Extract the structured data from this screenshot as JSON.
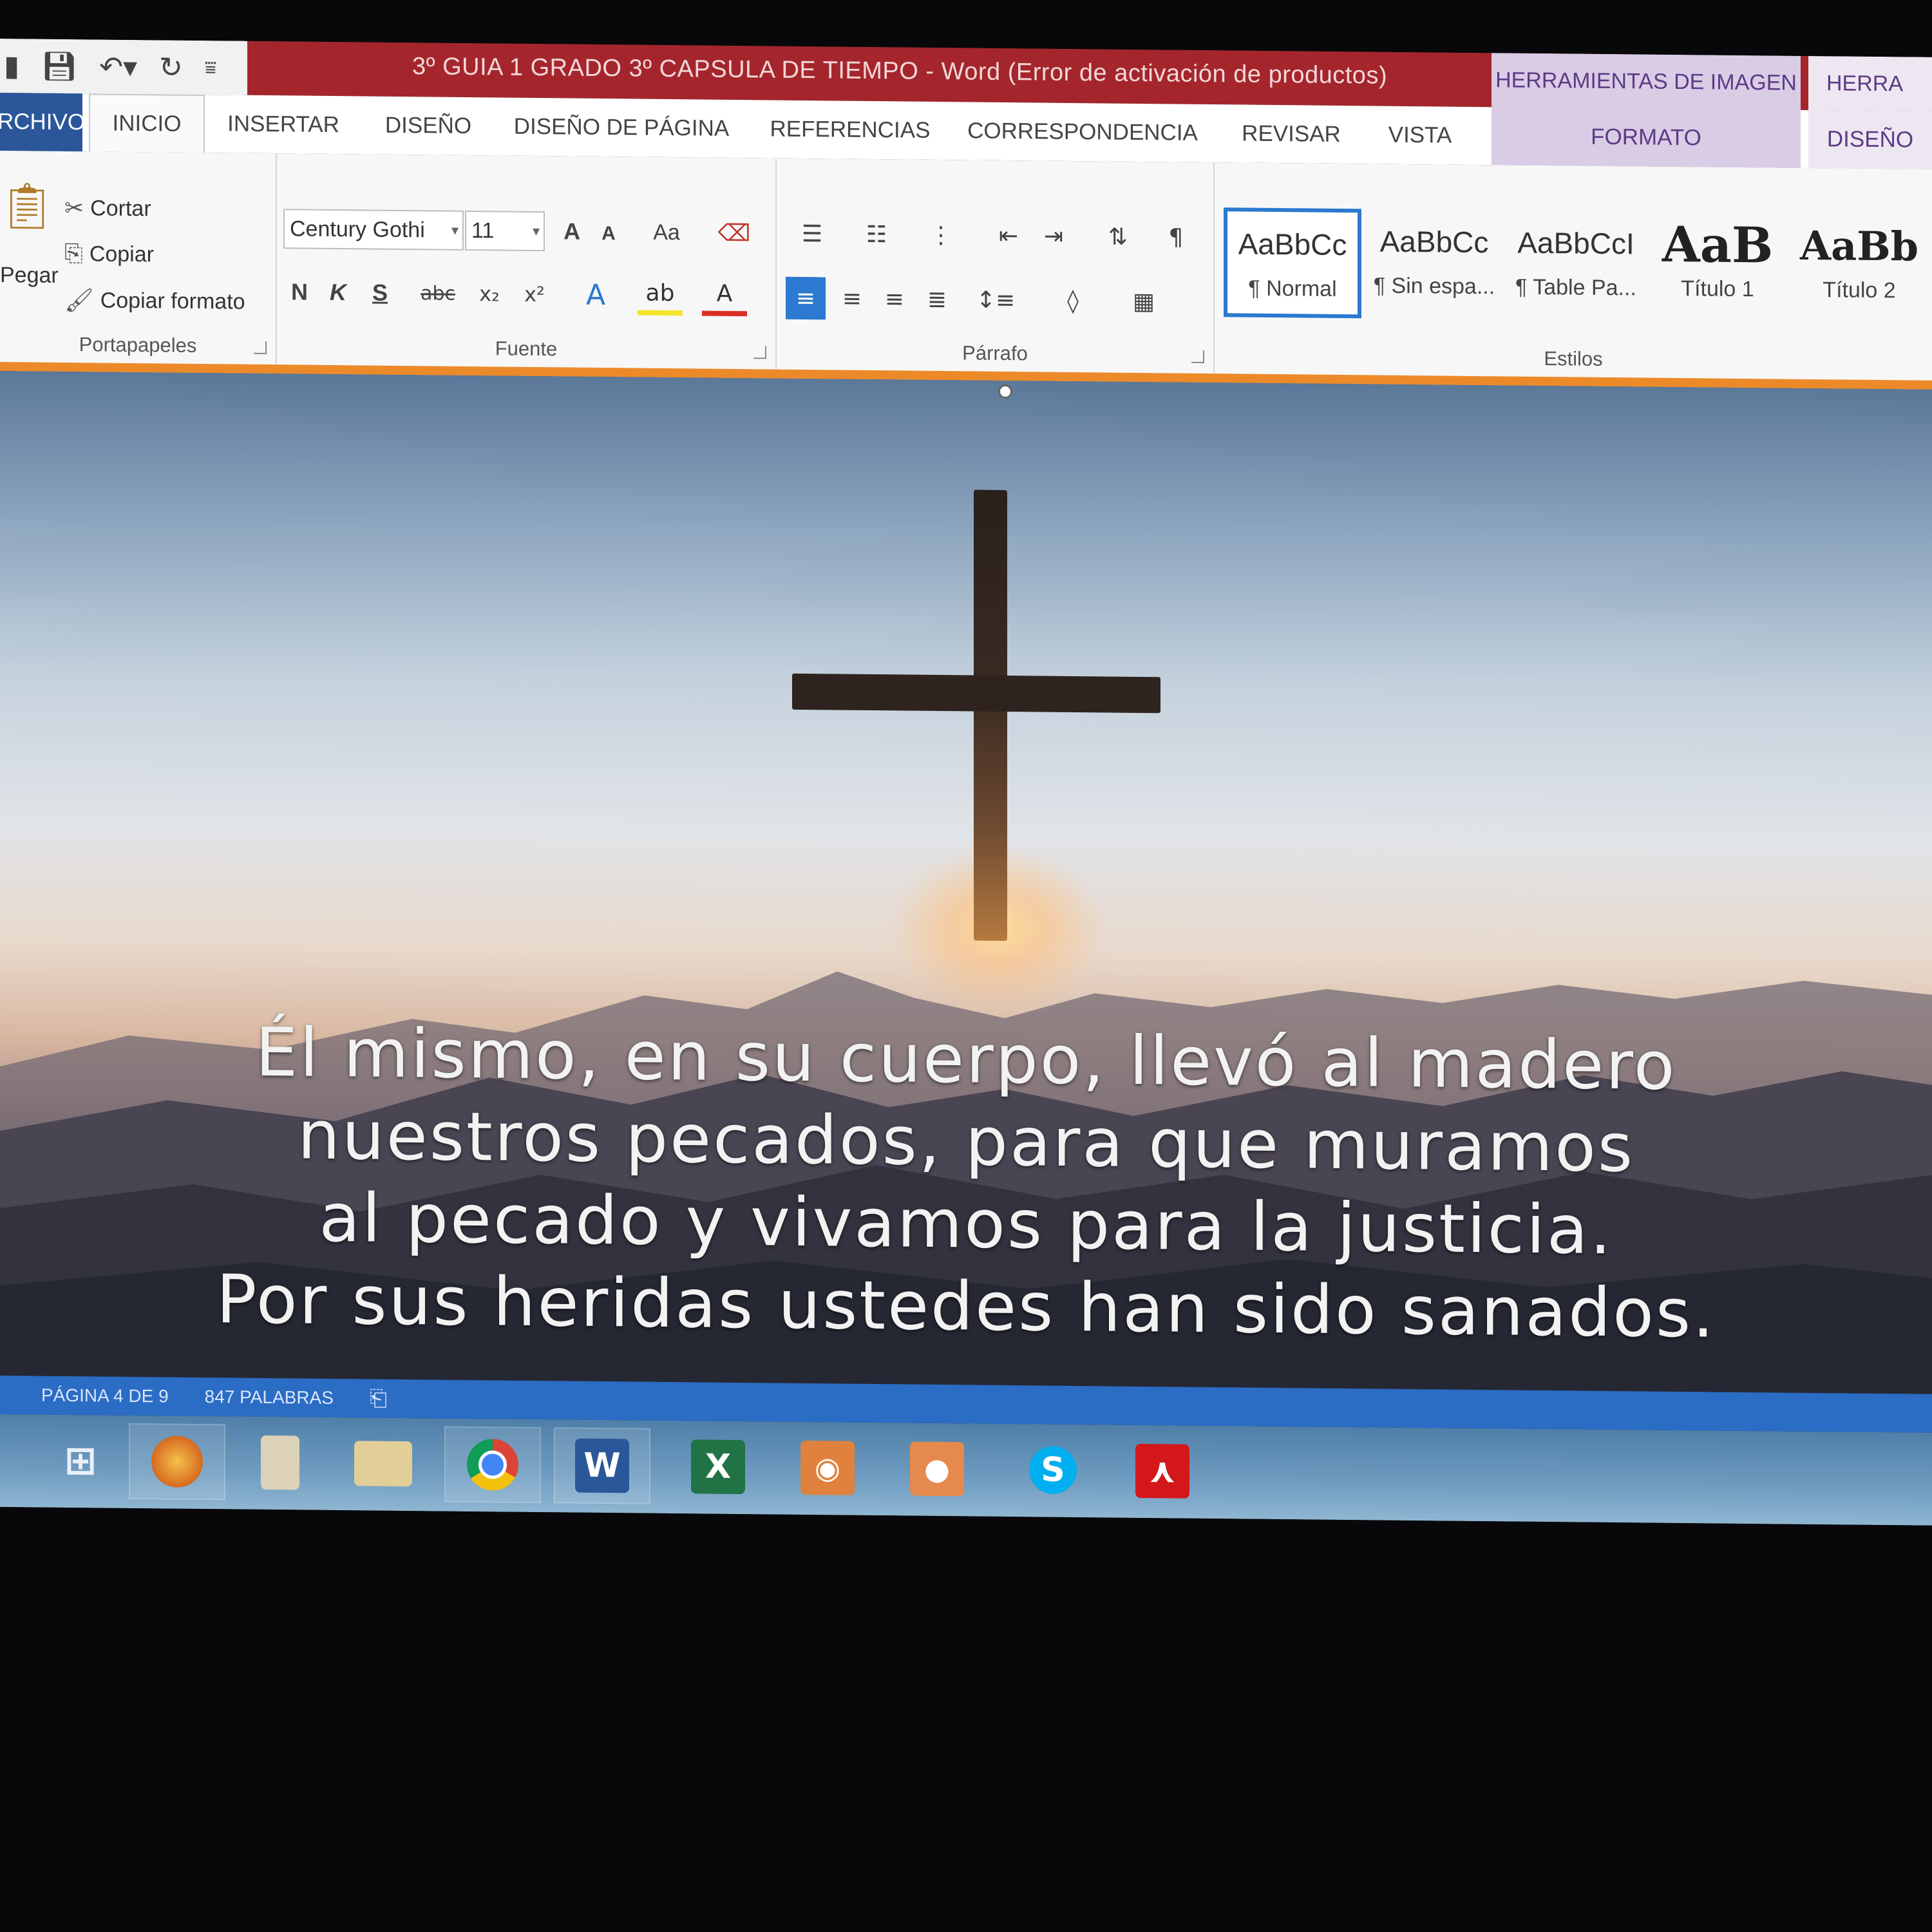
{
  "window": {
    "title": "3º GUIA 1 GRADO 3º CAPSULA DE TIEMPO - Word (Error de activación de productos)",
    "context_group_1": "HERRAMIENTAS DE IMAGEN",
    "context_group_2": "HERRA",
    "qat": [
      "save-icon",
      "undo-icon",
      "redo-icon",
      "customize-icon"
    ]
  },
  "tabs": [
    {
      "label": "RCHIVO"
    },
    {
      "label": "INICIO"
    },
    {
      "label": "INSERTAR"
    },
    {
      "label": "DISEÑO"
    },
    {
      "label": "DISEÑO DE PÁGINA"
    },
    {
      "label": "REFERENCIAS"
    },
    {
      "label": "CORRESPONDENCIA"
    },
    {
      "label": "REVISAR"
    },
    {
      "label": "VISTA"
    },
    {
      "label": "FORMATO"
    },
    {
      "label": "DISEÑO"
    }
  ],
  "clipboard": {
    "paste": "Pegar",
    "cut": "Cortar",
    "copy": "Copiar",
    "format_painter": "Copiar formato",
    "group_label": "Portapapeles"
  },
  "font": {
    "family": "Century Gothi",
    "size": "11",
    "grow": "A",
    "shrink": "A",
    "change_case": "Aa",
    "bold": "N",
    "italic": "K",
    "underline": "S",
    "strikethrough": "abc",
    "subscript": "x₂",
    "superscript": "x²",
    "group_label": "Fuente"
  },
  "paragraph": {
    "group_label": "Párrafo"
  },
  "styles": {
    "group_label": "Estilos",
    "items": [
      {
        "preview": "AaBbCc",
        "name": "¶ Normal"
      },
      {
        "preview": "AaBbCc",
        "name": "¶ Sin espa..."
      },
      {
        "preview": "AaBbCcI",
        "name": "¶ Table Pa..."
      },
      {
        "preview": "AaB",
        "name": "Título 1"
      },
      {
        "preview": "AaBb",
        "name": "Título 2"
      }
    ]
  },
  "document": {
    "verse_lines": [
      "Él mismo, en su cuerpo, llevó al madero",
      "nuestros pecados, para que muramos",
      "al pecado y vivamos para la justicia.",
      "Por sus heridas ustedes han sido sanados."
    ]
  },
  "status": {
    "page": "PÁGINA 4 DE 9",
    "words": "847 PALABRAS"
  },
  "taskbar": [
    "start-icon",
    "browser-icon",
    "file-explorer-icon",
    "folder-icon",
    "chrome-icon",
    "word-icon",
    "excel-icon",
    "camera-icon",
    "capture-icon",
    "skype-icon",
    "acrobat-icon"
  ]
}
